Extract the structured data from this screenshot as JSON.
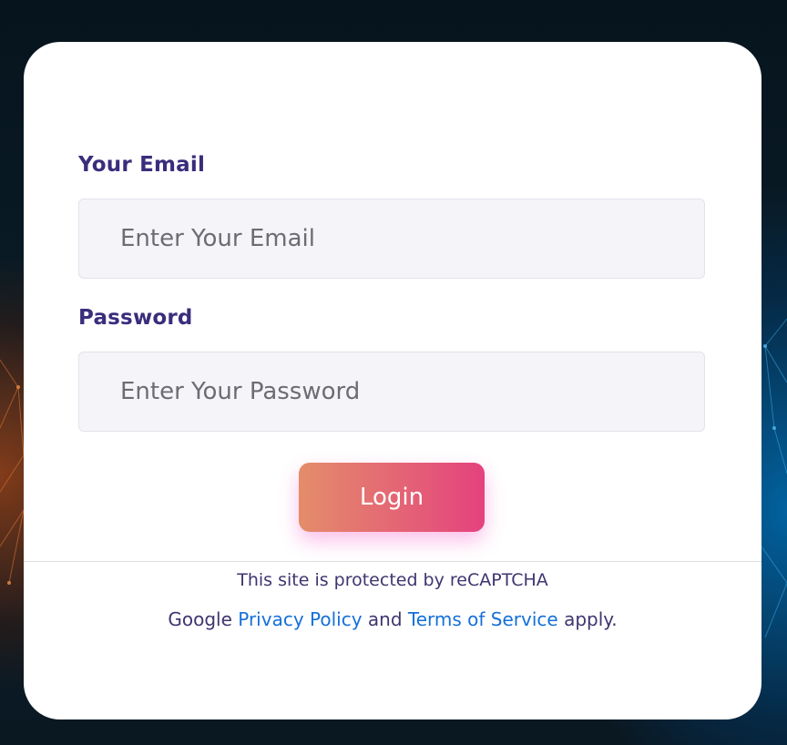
{
  "login_form": {
    "email_label": "Your Email",
    "email_placeholder": "Enter Your Email",
    "email_value": "",
    "password_label": "Password",
    "password_placeholder": "Enter Your Password",
    "password_value": "",
    "login_button_label": "Login"
  },
  "recaptcha": {
    "line1": "This site is protected by reCAPTCHA",
    "google_text": "Google",
    "privacy_policy_link": "Privacy Policy",
    "and_text": "and",
    "terms_link": "Terms of Service",
    "apply_text": "apply."
  },
  "colors": {
    "label_color": "#3a2d7c",
    "link_color": "#1570d8",
    "button_gradient_start": "#e48d6a",
    "button_gradient_end": "#e4427e",
    "input_background": "#f5f5f9"
  },
  "icons": {
    "background": "network-mesh-background"
  }
}
